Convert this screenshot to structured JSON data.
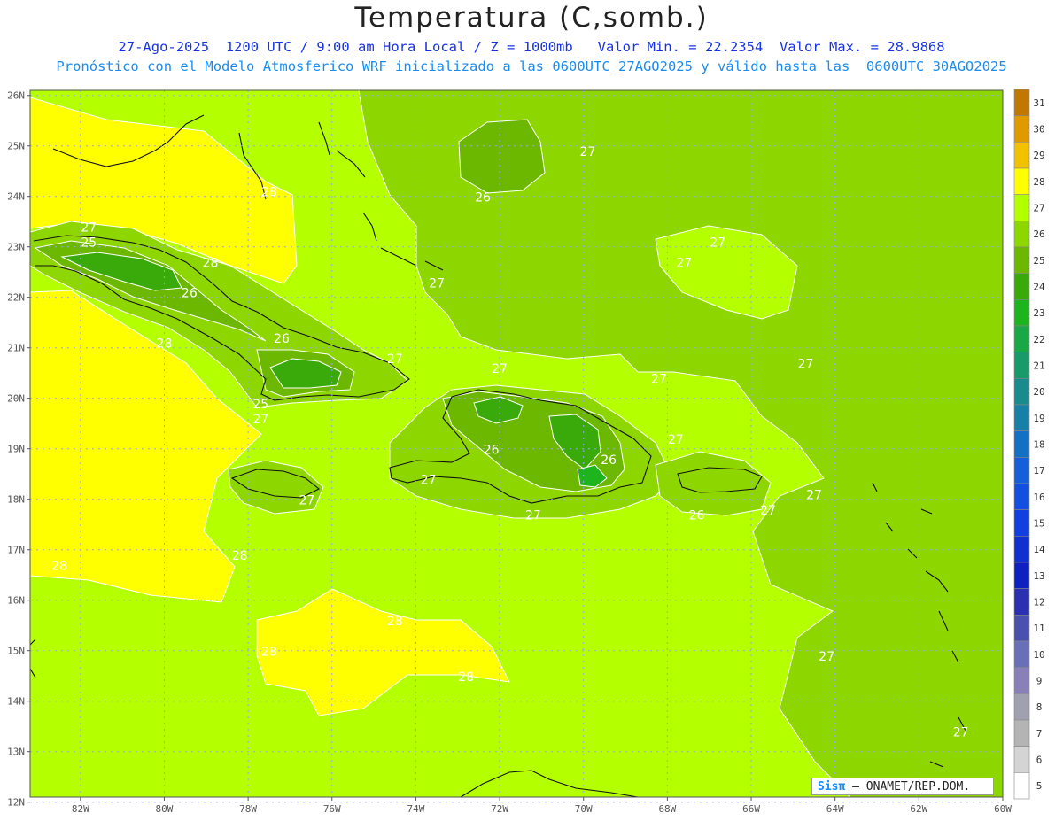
{
  "header": {
    "title": "Temperatura (C,somb.)",
    "line1": "27-Ago-2025  1200 UTC / 9:00 am Hora Local / Z = 1000mb   Valor Min. = 22.2354  Valor Max. = 28.9868",
    "line2": "Pronóstico con el Modelo Atmosferico WRF inicializado a las 0600UTC_27AGO2025 y válido hasta las  0600UTC_30AGO2025"
  },
  "axes": {
    "lat_labels": [
      "26N",
      "25N",
      "24N",
      "23N",
      "22N",
      "21N",
      "20N",
      "19N",
      "18N",
      "17N",
      "16N",
      "15N",
      "14N",
      "13N",
      "12N"
    ],
    "lon_labels": [
      "82W",
      "80W",
      "78W",
      "76W",
      "74W",
      "72W",
      "70W",
      "68W",
      "66W",
      "64W",
      "62W",
      "60W"
    ]
  },
  "colorbar": {
    "levels": [
      "31",
      "30",
      "29",
      "28",
      "27",
      "26",
      "25",
      "24",
      "23",
      "22",
      "21",
      "20",
      "19",
      "18",
      "17",
      "16",
      "15",
      "14",
      "13",
      "12",
      "11",
      "10",
      "9",
      "8",
      "7",
      "6",
      "5"
    ],
    "colors": [
      "#c07800",
      "#e09a00",
      "#f2c200",
      "#ffff00",
      "#b4ff00",
      "#8ed600",
      "#6cb800",
      "#3aaa0a",
      "#1eb41e",
      "#1aa846",
      "#1a9a6a",
      "#188c8c",
      "#1680a8",
      "#1470c4",
      "#1460d8",
      "#1450e0",
      "#1240e0",
      "#1030d0",
      "#1020c0",
      "#2a30b0",
      "#4a50b0",
      "#6a70b8",
      "#8a80b8",
      "#a0a0b0",
      "#b4b4b4",
      "#d4d4d4",
      "#ffffff"
    ]
  },
  "contour_labels": [
    {
      "text": "27",
      "lon": -69.9,
      "lat": 24.8
    },
    {
      "text": "26",
      "lon": -72.4,
      "lat": 23.9
    },
    {
      "text": "28",
      "lon": -77.5,
      "lat": 24.0
    },
    {
      "text": "27",
      "lon": -81.8,
      "lat": 23.3
    },
    {
      "text": "25",
      "lon": -81.8,
      "lat": 23.0
    },
    {
      "text": "28",
      "lon": -78.9,
      "lat": 22.6
    },
    {
      "text": "26",
      "lon": -79.4,
      "lat": 22.0
    },
    {
      "text": "27",
      "lon": -73.5,
      "lat": 22.2
    },
    {
      "text": "27",
      "lon": -67.6,
      "lat": 22.6
    },
    {
      "text": "27",
      "lon": -66.8,
      "lat": 23.0
    },
    {
      "text": "26",
      "lon": -77.2,
      "lat": 21.1
    },
    {
      "text": "28",
      "lon": -80.0,
      "lat": 21.0
    },
    {
      "text": "27",
      "lon": -74.5,
      "lat": 20.7
    },
    {
      "text": "27",
      "lon": -72.0,
      "lat": 20.5
    },
    {
      "text": "27",
      "lon": -68.2,
      "lat": 20.3
    },
    {
      "text": "27",
      "lon": -64.7,
      "lat": 20.6
    },
    {
      "text": "25",
      "lon": -77.7,
      "lat": 19.8
    },
    {
      "text": "27",
      "lon": -77.7,
      "lat": 19.5
    },
    {
      "text": "27",
      "lon": -67.8,
      "lat": 19.1
    },
    {
      "text": "26",
      "lon": -72.2,
      "lat": 18.9
    },
    {
      "text": "26",
      "lon": -69.4,
      "lat": 18.7
    },
    {
      "text": "27",
      "lon": -73.7,
      "lat": 18.3
    },
    {
      "text": "27",
      "lon": -76.6,
      "lat": 17.9
    },
    {
      "text": "27",
      "lon": -71.2,
      "lat": 17.6
    },
    {
      "text": "26",
      "lon": -67.3,
      "lat": 17.6
    },
    {
      "text": "27",
      "lon": -65.6,
      "lat": 17.7
    },
    {
      "text": "27",
      "lon": -64.5,
      "lat": 18.0
    },
    {
      "text": "28",
      "lon": -82.5,
      "lat": 16.6
    },
    {
      "text": "28",
      "lon": -78.2,
      "lat": 16.8
    },
    {
      "text": "28",
      "lon": -74.5,
      "lat": 15.5
    },
    {
      "text": "28",
      "lon": -77.5,
      "lat": 14.9
    },
    {
      "text": "28",
      "lon": -72.8,
      "lat": 14.4
    },
    {
      "text": "27",
      "lon": -64.2,
      "lat": 14.8
    },
    {
      "text": "27",
      "lon": -61.0,
      "lat": 13.3
    }
  ],
  "credit": {
    "logo": "Sisπ",
    "text": " – ONAMET/REP.DOM."
  }
}
